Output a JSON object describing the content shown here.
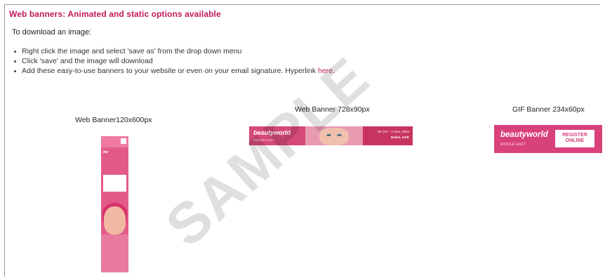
{
  "header": {
    "title": "Web banners: Animated and static options available",
    "subheading": "To download an image:"
  },
  "instructions": [
    "Right click the image and select 'save as' from the drop down menu",
    "Click 'save' and the image will download",
    "Add these easy-to-use banners to your website or even on your email signature. Hyperlink"
  ],
  "hyperlink_text": "here.",
  "banners": {
    "vertical": {
      "caption": "Web Banner120x600px"
    },
    "horizontal": {
      "caption": "Web Banner 728x90px",
      "logo": "beautyworld",
      "sub": "MIDDLE EAST",
      "dates": "30 Oct – 1 Nov, 2023",
      "location": "Dubai, UAE"
    },
    "gif": {
      "caption": "GIF Banner 234x60px",
      "logo": "beautyworld",
      "sub": "MIDDLE EAST",
      "cta_line1": "REGISTER",
      "cta_line2": "ONLINE"
    }
  },
  "watermark": "SAMPLE",
  "colors": {
    "accent": "#c2185b",
    "banner_pink": "#d9417b"
  }
}
